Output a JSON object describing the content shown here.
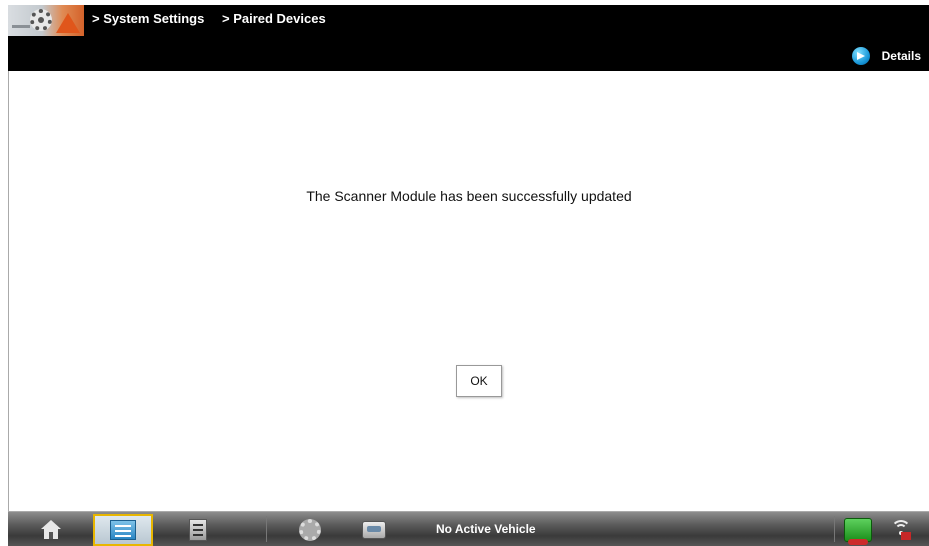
{
  "header": {
    "breadcrumb": [
      "> System Settings",
      "> Paired Devices"
    ],
    "details_label": "Details",
    "logo_icon": "system-settings-gear-icon"
  },
  "dialog": {
    "message": "The Scanner Module has been successfully updated",
    "ok_label": "OK"
  },
  "taskbar": {
    "items": [
      {
        "name": "home",
        "icon": "home-icon"
      },
      {
        "name": "scanner",
        "icon": "scanner-icon",
        "active": true
      },
      {
        "name": "modules",
        "icon": "modules-icon"
      },
      {
        "name": "settings",
        "icon": "gear-icon"
      },
      {
        "name": "vehicle",
        "icon": "vehicle-icon"
      }
    ],
    "vehicle_status": "No Active Vehicle",
    "connect_icon": "vehicle-connection-icon",
    "wifi_icon": "wifi-icon"
  },
  "colors": {
    "header_bg": "#000000",
    "active_highlight": "#e8b600",
    "details_icon": "#1594d6"
  }
}
